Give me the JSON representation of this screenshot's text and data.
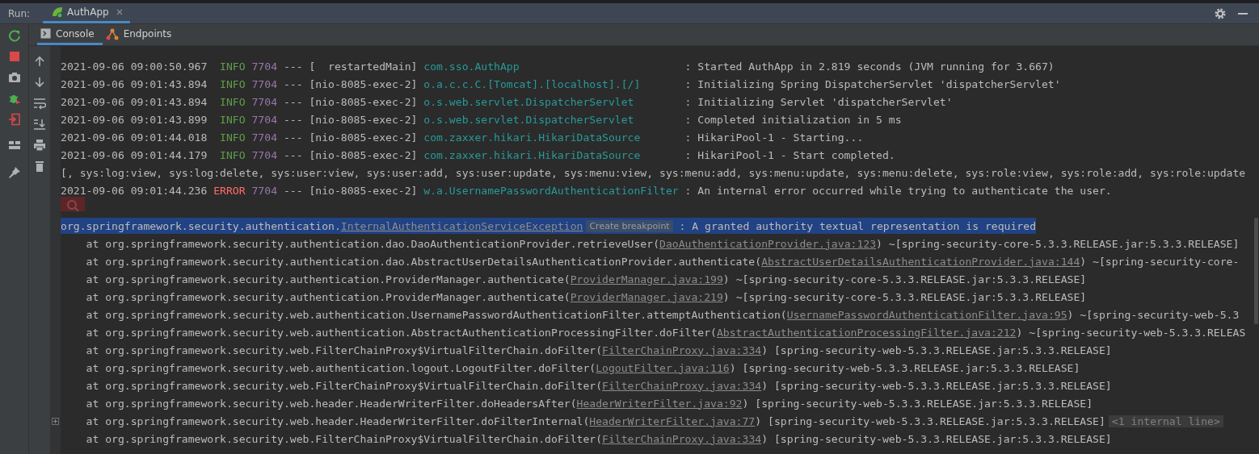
{
  "run_bar": {
    "label": "Run:",
    "tabs": [
      {
        "label": "AuthApp",
        "selected": true
      }
    ]
  },
  "console_tabs": [
    {
      "label": "Console",
      "selected": true
    },
    {
      "label": "Endpoints",
      "selected": false
    }
  ],
  "lines": [
    {
      "kind": "log",
      "time": "2021-09-06 09:00:50.967",
      "level": "INFO",
      "pid": "7704",
      "separator": "---",
      "thread": "[  restartedMain]",
      "logger": "com.sso.AuthApp",
      "message": ": Started AuthApp in 2.819 seconds (JVM running for 3.667)"
    },
    {
      "kind": "log",
      "time": "2021-09-06 09:01:43.894",
      "level": "INFO",
      "pid": "7704",
      "separator": "---",
      "thread": "[nio-8085-exec-2]",
      "logger": "o.a.c.c.C.[Tomcat].[localhost].[/]",
      "message": ": Initializing Spring DispatcherServlet 'dispatcherServlet'"
    },
    {
      "kind": "log",
      "time": "2021-09-06 09:01:43.894",
      "level": "INFO",
      "pid": "7704",
      "separator": "---",
      "thread": "[nio-8085-exec-2]",
      "logger": "o.s.web.servlet.DispatcherServlet",
      "message": ": Initializing Servlet 'dispatcherServlet'"
    },
    {
      "kind": "log",
      "time": "2021-09-06 09:01:43.899",
      "level": "INFO",
      "pid": "7704",
      "separator": "---",
      "thread": "[nio-8085-exec-2]",
      "logger": "o.s.web.servlet.DispatcherServlet",
      "message": ": Completed initialization in 5 ms"
    },
    {
      "kind": "log",
      "time": "2021-09-06 09:01:44.018",
      "level": "INFO",
      "pid": "7704",
      "separator": "---",
      "thread": "[nio-8085-exec-2]",
      "logger": "com.zaxxer.hikari.HikariDataSource",
      "message": ": HikariPool-1 - Starting..."
    },
    {
      "kind": "log",
      "time": "2021-09-06 09:01:44.179",
      "level": "INFO",
      "pid": "7704",
      "separator": "---",
      "thread": "[nio-8085-exec-2]",
      "logger": "com.zaxxer.hikari.HikariDataSource",
      "message": ": HikariPool-1 - Start completed."
    },
    {
      "kind": "plain",
      "text": "[, sys:log:view, sys:log:delete, sys:user:view, sys:user:add, sys:user:update, sys:menu:view, sys:menu:add, sys:menu:update, sys:menu:delete, sys:role:view, sys:role:add, sys:role:update"
    },
    {
      "kind": "log",
      "time": "2021-09-06 09:01:44.236",
      "level": "ERROR",
      "pid": "7704",
      "separator": "---",
      "thread": "[nio-8085-exec-2]",
      "logger": "w.a.UsernamePasswordAuthenticationFilter",
      "message": ": An internal error occurred while trying to authenticate the user."
    },
    {
      "kind": "exception",
      "selected": true,
      "foldable": false,
      "segments": [
        {
          "kind": "text",
          "text": "org.springframework.security.authentication."
        },
        {
          "kind": "link",
          "text": "InternalAuthenticationServiceException"
        },
        {
          "kind": "hint",
          "text": "Create breakpoint"
        },
        {
          "kind": "text",
          "text": " : A granted authority textual representation is required"
        }
      ]
    },
    {
      "kind": "trace",
      "selected": false,
      "foldable": false,
      "segments": [
        {
          "kind": "text",
          "text": "at org.springframework.security.authentication.dao.DaoAuthenticationProvider.retrieveUser("
        },
        {
          "kind": "link",
          "text": "DaoAuthenticationProvider.java:123"
        },
        {
          "kind": "text",
          "text": ") ~[spring-security-core-5.3.3.RELEASE.jar:5.3.3.RELEASE]"
        }
      ]
    },
    {
      "kind": "trace",
      "selected": false,
      "foldable": false,
      "segments": [
        {
          "kind": "text",
          "text": "at org.springframework.security.authentication.dao.AbstractUserDetailsAuthenticationProvider.authenticate("
        },
        {
          "kind": "link",
          "text": "AbstractUserDetailsAuthenticationProvider.java:144"
        },
        {
          "kind": "text",
          "text": ") ~[spring-security-core-"
        }
      ]
    },
    {
      "kind": "trace",
      "selected": false,
      "foldable": false,
      "segments": [
        {
          "kind": "text",
          "text": "at org.springframework.security.authentication.ProviderManager.authenticate("
        },
        {
          "kind": "link",
          "text": "ProviderManager.java:199"
        },
        {
          "kind": "text",
          "text": ") ~[spring-security-core-5.3.3.RELEASE.jar:5.3.3.RELEASE]"
        }
      ]
    },
    {
      "kind": "trace",
      "selected": false,
      "foldable": false,
      "segments": [
        {
          "kind": "text",
          "text": "at org.springframework.security.authentication.ProviderManager.authenticate("
        },
        {
          "kind": "link",
          "text": "ProviderManager.java:219"
        },
        {
          "kind": "text",
          "text": ") ~[spring-security-core-5.3.3.RELEASE.jar:5.3.3.RELEASE]"
        }
      ]
    },
    {
      "kind": "trace",
      "selected": false,
      "foldable": false,
      "segments": [
        {
          "kind": "text",
          "text": "at org.springframework.security.web.authentication.UsernamePasswordAuthenticationFilter.attemptAuthentication("
        },
        {
          "kind": "link",
          "text": "UsernamePasswordAuthenticationFilter.java:95"
        },
        {
          "kind": "text",
          "text": ") ~[spring-security-web-5.3"
        }
      ]
    },
    {
      "kind": "trace",
      "selected": false,
      "foldable": false,
      "segments": [
        {
          "kind": "text",
          "text": "at org.springframework.security.web.authentication.AbstractAuthenticationProcessingFilter.doFilter("
        },
        {
          "kind": "link",
          "text": "AbstractAuthenticationProcessingFilter.java:212"
        },
        {
          "kind": "text",
          "text": ") ~[spring-security-web-5.3.3.RELEAS"
        }
      ]
    },
    {
      "kind": "trace",
      "selected": false,
      "foldable": false,
      "segments": [
        {
          "kind": "text",
          "text": "at org.springframework.security.web.FilterChainProxy$VirtualFilterChain.doFilter("
        },
        {
          "kind": "link",
          "text": "FilterChainProxy.java:334"
        },
        {
          "kind": "text",
          "text": ") [spring-security-web-5.3.3.RELEASE.jar:5.3.3.RELEASE]"
        }
      ]
    },
    {
      "kind": "trace",
      "selected": false,
      "foldable": false,
      "segments": [
        {
          "kind": "text",
          "text": "at org.springframework.security.web.authentication.logout.LogoutFilter.doFilter("
        },
        {
          "kind": "link",
          "text": "LogoutFilter.java:116"
        },
        {
          "kind": "text",
          "text": ") [spring-security-web-5.3.3.RELEASE.jar:5.3.3.RELEASE]"
        }
      ]
    },
    {
      "kind": "trace",
      "selected": false,
      "foldable": false,
      "segments": [
        {
          "kind": "text",
          "text": "at org.springframework.security.web.FilterChainProxy$VirtualFilterChain.doFilter("
        },
        {
          "kind": "link",
          "text": "FilterChainProxy.java:334"
        },
        {
          "kind": "text",
          "text": ") [spring-security-web-5.3.3.RELEASE.jar:5.3.3.RELEASE]"
        }
      ]
    },
    {
      "kind": "trace",
      "selected": false,
      "foldable": false,
      "segments": [
        {
          "kind": "text",
          "text": "at org.springframework.security.web.header.HeaderWriterFilter.doHeadersAfter("
        },
        {
          "kind": "link",
          "text": "HeaderWriterFilter.java:92"
        },
        {
          "kind": "text",
          "text": ") [spring-security-web-5.3.3.RELEASE.jar:5.3.3.RELEASE]"
        }
      ]
    },
    {
      "kind": "trace",
      "selected": false,
      "foldable": true,
      "segments": [
        {
          "kind": "text",
          "text": "at org.springframework.security.web.header.HeaderWriterFilter.doFilterInternal("
        },
        {
          "kind": "link",
          "text": "HeaderWriterFilter.java:77"
        },
        {
          "kind": "text",
          "text": ") [spring-security-web-5.3.3.RELEASE.jar:5.3.3.RELEASE]"
        },
        {
          "kind": "fold",
          "text": "<1 internal line>"
        }
      ]
    },
    {
      "kind": "trace",
      "selected": false,
      "foldable": false,
      "segments": [
        {
          "kind": "text",
          "text": "at org.springframework.security.web.FilterChainProxy$VirtualFilterChain.doFilter("
        },
        {
          "kind": "link",
          "text": "FilterChainProxy.java:334"
        },
        {
          "kind": "text",
          "text": ") [spring-security-web-5.3.3.RELEASE.jar:5.3.3.RELEASE]"
        }
      ]
    }
  ]
}
